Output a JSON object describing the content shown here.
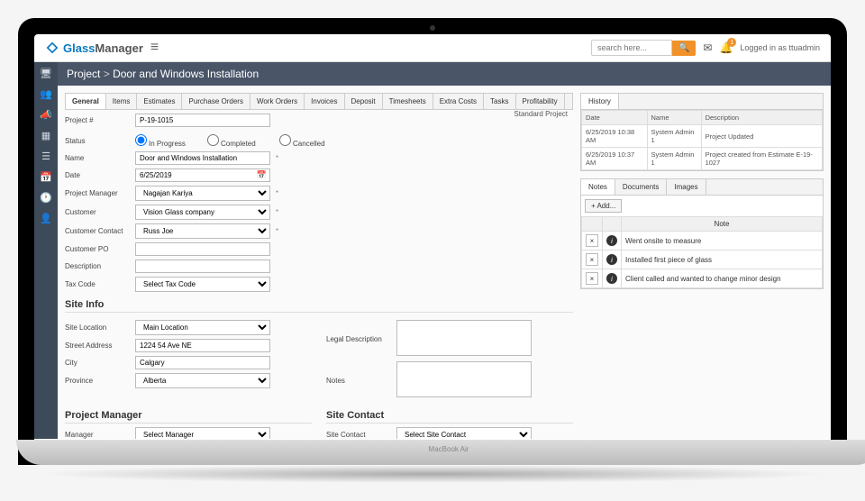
{
  "brand": {
    "part1": "Glass",
    "part2": "Manager"
  },
  "search": {
    "placeholder": "search here...",
    "btn_icon": "🔍"
  },
  "notif_count": "1",
  "login_text": "Logged in as ttuadmin",
  "breadcrumb": {
    "root": "Project",
    "sep": ">",
    "current": "Door and Windows Installation"
  },
  "tabs": [
    "General",
    "Items",
    "Estimates",
    "Purchase Orders",
    "Work Orders",
    "Invoices",
    "Deposit",
    "Timesheets",
    "Extra Costs",
    "Tasks",
    "Profitability"
  ],
  "form": {
    "project_no_label": "Project #",
    "project_no": "P-19-1015",
    "standard_project": "Standard Project",
    "status_label": "Status",
    "status_opts": {
      "in_progress": "In Progress",
      "completed": "Completed",
      "cancelled": "Cancelled"
    },
    "name_label": "Name",
    "name": "Door and Windows Installation",
    "date_label": "Date",
    "date": "6/25/2019",
    "pm_label": "Project Manager",
    "pm": "Nagajan Kariya",
    "customer_label": "Customer",
    "customer": "Vision Glass company",
    "contact_label": "Customer Contact",
    "contact": "Russ Joe",
    "po_label": "Customer PO",
    "po": "",
    "desc_label": "Description",
    "desc": "",
    "tax_label": "Tax Code",
    "tax": "Select Tax Code"
  },
  "site": {
    "heading": "Site Info",
    "location_label": "Site Location",
    "location": "Main Location",
    "street_label": "Street Address",
    "street": "1224 54 Ave NE",
    "city_label": "City",
    "city": "Calgary",
    "province_label": "Province",
    "province": "Alberta",
    "legal_label": "Legal Description",
    "notes_label": "Notes"
  },
  "pm_section": {
    "heading": "Project Manager",
    "manager_label": "Manager",
    "manager": "Select Manager"
  },
  "sc_section": {
    "heading": "Site Contact",
    "label": "Site Contact",
    "value": "Select Site Contact"
  },
  "history": {
    "tab": "History",
    "cols": {
      "date": "Date",
      "name": "Name",
      "desc": "Description"
    },
    "rows": [
      {
        "date": "6/25/2019 10:38 AM",
        "name": "System Admin 1",
        "desc": "Project Updated"
      },
      {
        "date": "6/25/2019 10:37 AM",
        "name": "System Admin 1",
        "desc": "Project created from Estimate E-19-1027"
      }
    ]
  },
  "notes_panel": {
    "tabs": [
      "Notes",
      "Documents",
      "Images"
    ],
    "add": "+ Add...",
    "col": "Note",
    "rows": [
      "Went onsite to measure",
      "Installed first piece of glass",
      "Client called and wanted to change minor design"
    ]
  }
}
